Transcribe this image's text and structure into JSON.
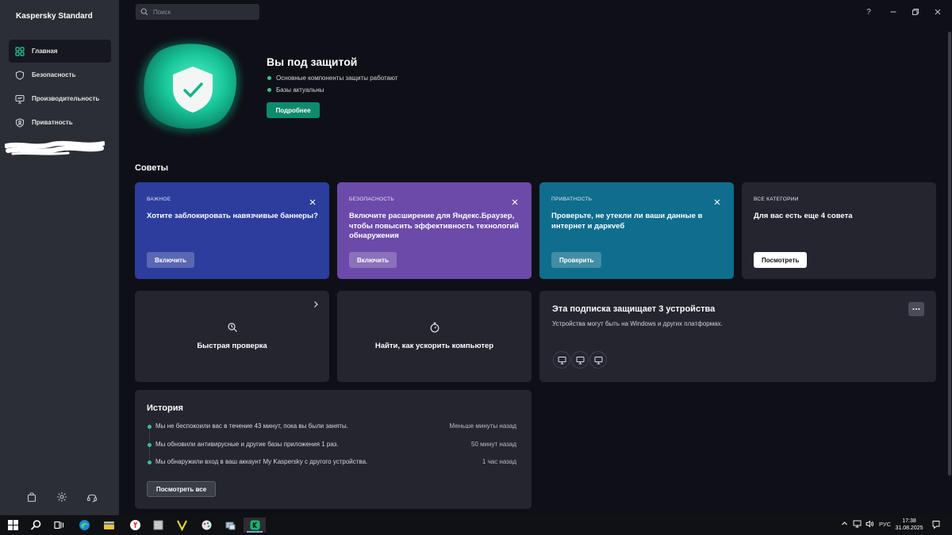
{
  "app": {
    "title": "Kaspersky Standard",
    "colors": {
      "accent": "#0e8a6d",
      "sidebar": "#2b2e35",
      "background": "#0f1017"
    }
  },
  "search": {
    "placeholder": "Поиск"
  },
  "window_controls": {
    "help": "?",
    "icons": [
      "help-icon",
      "minimize-icon",
      "maximize-icon",
      "close-icon"
    ]
  },
  "sidebar": {
    "items": [
      {
        "label": "Главная",
        "icon": "dashboard-icon",
        "active": true
      },
      {
        "label": "Безопасность",
        "icon": "shield-icon",
        "active": false
      },
      {
        "label": "Производительность",
        "icon": "monitor-icon",
        "active": false
      },
      {
        "label": "Приватность",
        "icon": "privacy-icon",
        "active": false
      }
    ],
    "bottom_icons": [
      "shopping-bag-icon",
      "gear-icon",
      "headset-icon"
    ]
  },
  "status": {
    "title": "Вы под защитой",
    "bullets": [
      "Основные компоненты защиты работают",
      "Базы актуальны"
    ],
    "details_button": "Подробнее"
  },
  "tips": {
    "section_title": "Советы",
    "cards": [
      {
        "category": "ВАЖНОЕ",
        "text": "Хотите заблокировать навязчивые баннеры?",
        "button": "Включить",
        "color": "#2c3d9e",
        "closable": true
      },
      {
        "category": "БЕЗОПАСНОСТЬ",
        "text": "Включите расширение для Яндекс.Браузер, чтобы повысить эффективность технологий обнаружения",
        "button": "Включить",
        "color": "#6b4aa9",
        "closable": true
      },
      {
        "category": "ПРИВАТНОСТЬ",
        "text": "Проверьте, не утекли ли ваши данные в интернет и даркveб",
        "button": "Проверить",
        "color": "#0f6d8e",
        "closable": true
      },
      {
        "category": "ВСЕ КАТЕГОРИИ",
        "text": "Для вас есть еще 4 совета",
        "button": "Посмотреть",
        "color": "#24252e",
        "closable": false
      }
    ]
  },
  "actions": [
    {
      "label": "Быстрая проверка",
      "icon": "quick-scan-icon"
    },
    {
      "label": "Найти, как ускорить компьютер",
      "icon": "stopwatch-icon"
    }
  ],
  "subscription": {
    "title": "Эта подписка защищает 3 устройства",
    "description": "Устройства могут быть на Windows и других платформах.",
    "devices": [
      "device-monitor-icon",
      "device-monitor-icon",
      "device-monitor-icon"
    ]
  },
  "history": {
    "title": "История",
    "items": [
      {
        "text": "Мы не беспокоили вас в течение 43 минут, пока вы были заняты.",
        "time": "Меньше минуты назад"
      },
      {
        "text": "Мы обновили антивирусные и другие базы приложения 1 раз.",
        "time": "50 минут назад"
      },
      {
        "text": "Мы обнаружили вход в ваш аккаунт My Kaspersky с другого устройства.",
        "time": "1 час назад"
      }
    ],
    "view_all_button": "Посмотреть все"
  },
  "taskbar": {
    "apps": [
      "start-icon",
      "search-icon",
      "task-view-icon",
      "edge-icon",
      "explorer-icon",
      "yandex-icon",
      "app-icon",
      "v-app-icon",
      "paint-icon",
      "network-app-icon",
      "kaspersky-icon"
    ],
    "language": "РУС",
    "time": "17:38",
    "date": "31.08.2025"
  }
}
